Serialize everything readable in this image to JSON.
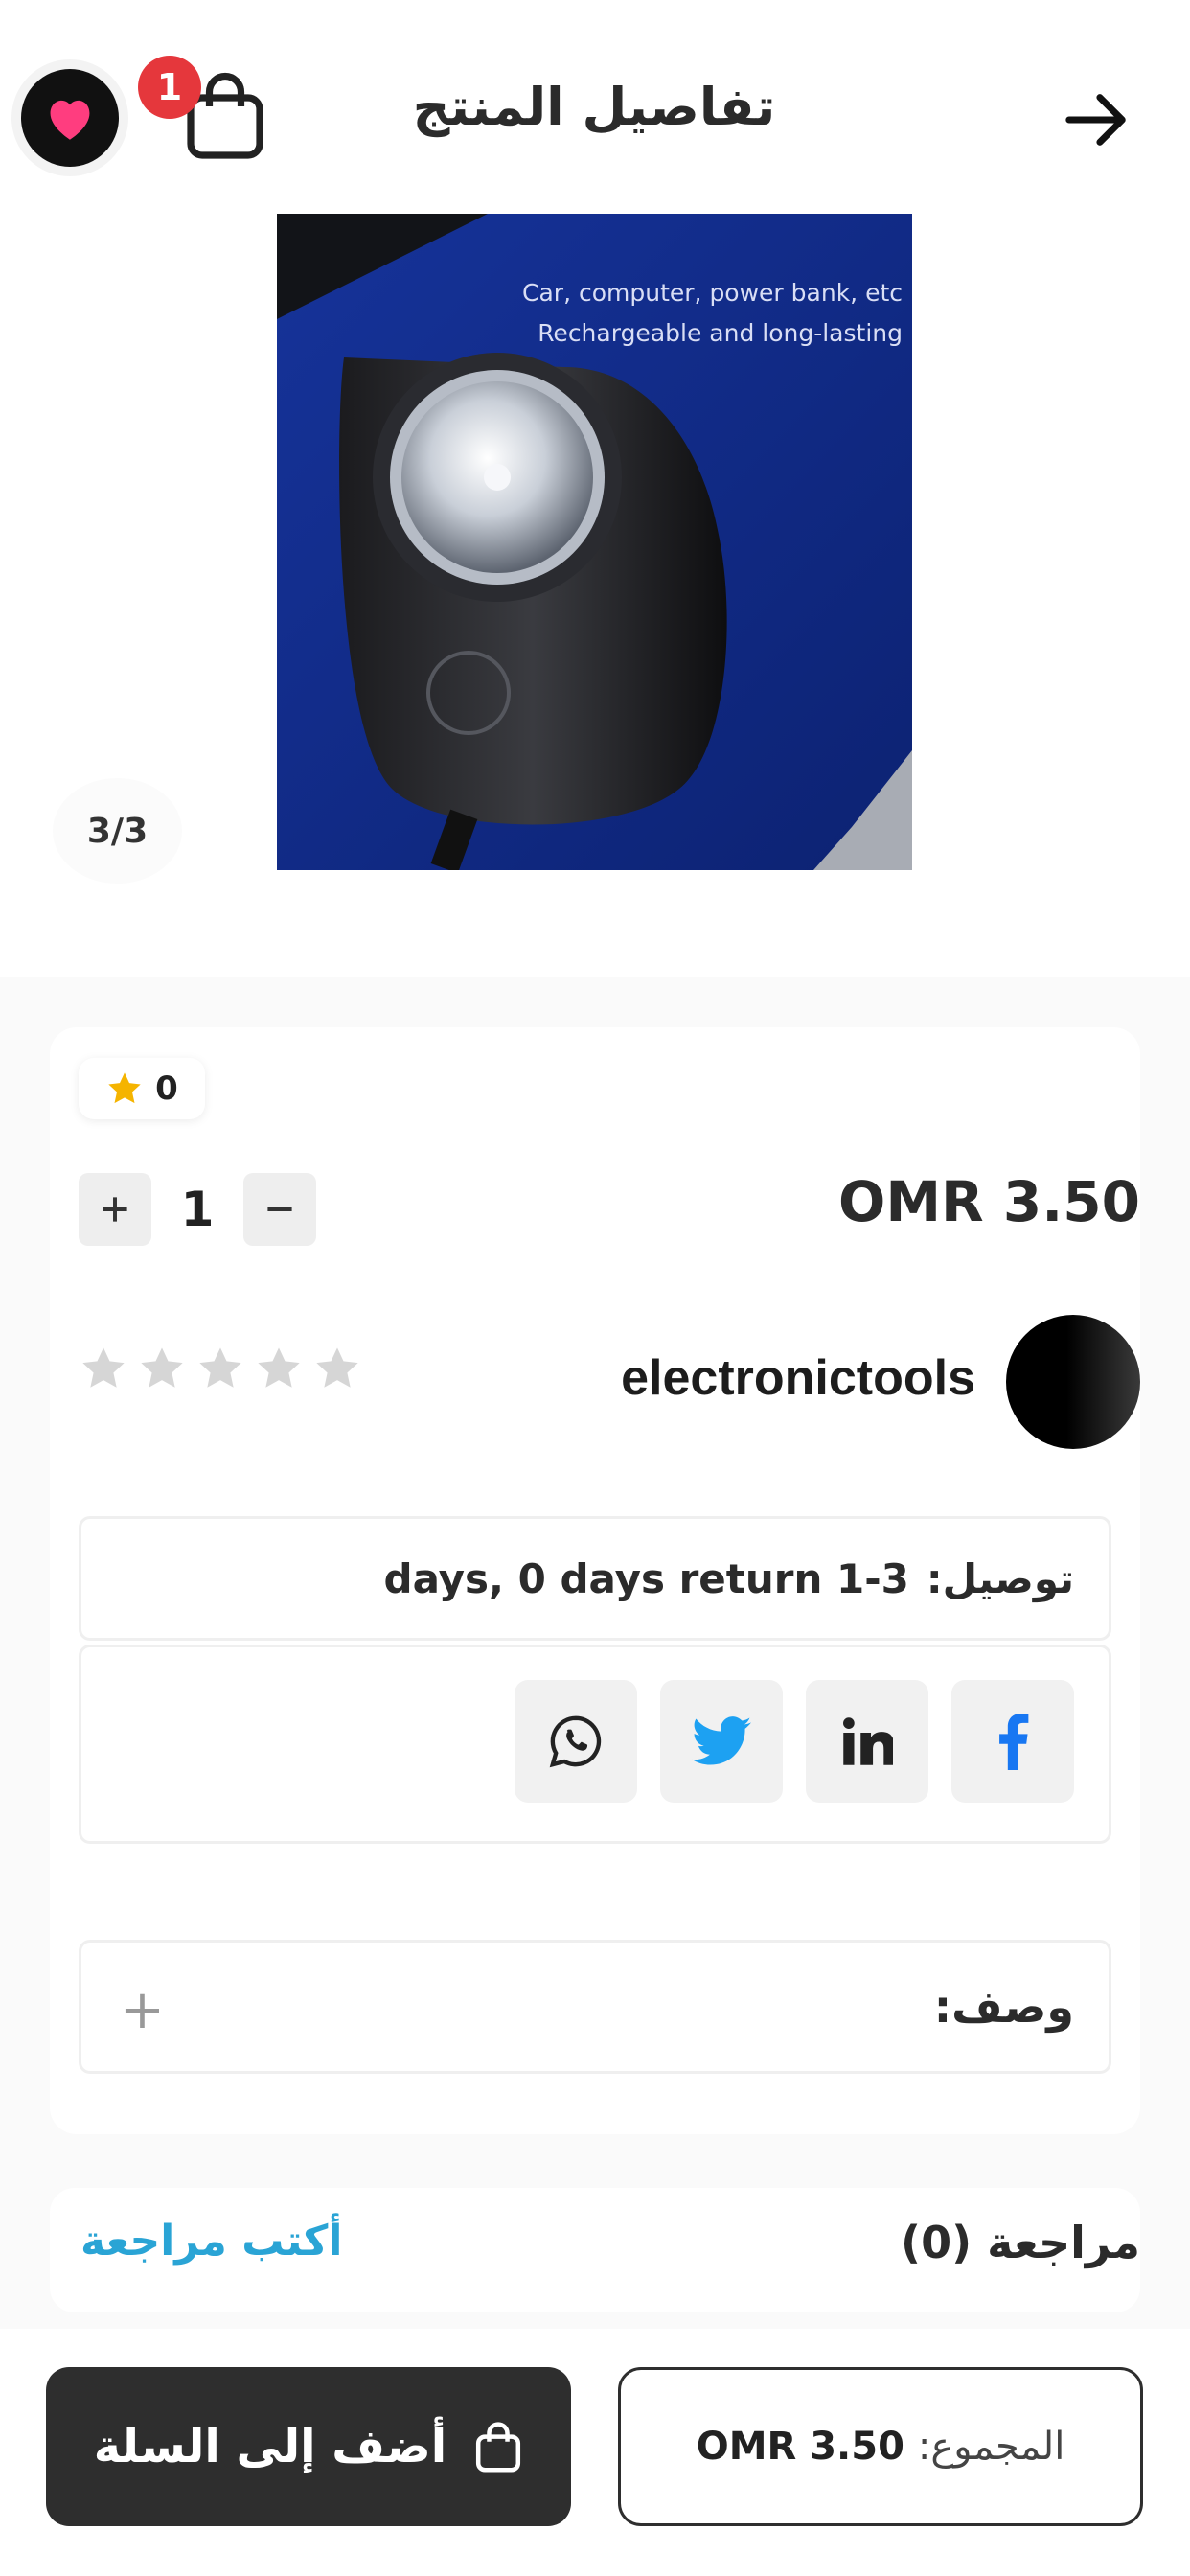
{
  "header": {
    "title": "تفاصيل المنتج",
    "cart_count": "1",
    "back_icon": "arrow-right-icon",
    "cart_icon": "shopping-bag-icon",
    "favorite_icon": "heart-icon"
  },
  "gallery": {
    "caption_line1": "Car, computer, power bank, etc",
    "caption_line2": "Rechargeable and long-lasting",
    "counter": "3/3"
  },
  "product": {
    "rating_count": "0",
    "quantity": "1",
    "price": "OMR 3.50",
    "seller_name": "electronictools",
    "stars_filled": 0,
    "stars_total": 5,
    "delivery_label": "توصيل:",
    "delivery_value": "days, 0 days return 1-3",
    "share": [
      "facebook-icon",
      "linkedin-icon",
      "twitter-icon",
      "whatsapp-icon"
    ],
    "description_label": "وصف:",
    "description_toggle": "+"
  },
  "reviews": {
    "title": "مراجعة (0)",
    "write_review": "أكتب مراجعة"
  },
  "bottom_bar": {
    "add_to_cart": "أضف إلى السلة",
    "total_label": "المجموع:",
    "total_value": "OMR 3.50"
  },
  "colors": {
    "badge": "#e5373c",
    "heart": "#ff3d7f",
    "link": "#2aa4d5",
    "facebook": "#1877f2",
    "twitter": "#1da1f2",
    "star_active": "#f5b400",
    "star_inactive": "#d6d6d6",
    "dark_button": "#2e2e2e"
  }
}
